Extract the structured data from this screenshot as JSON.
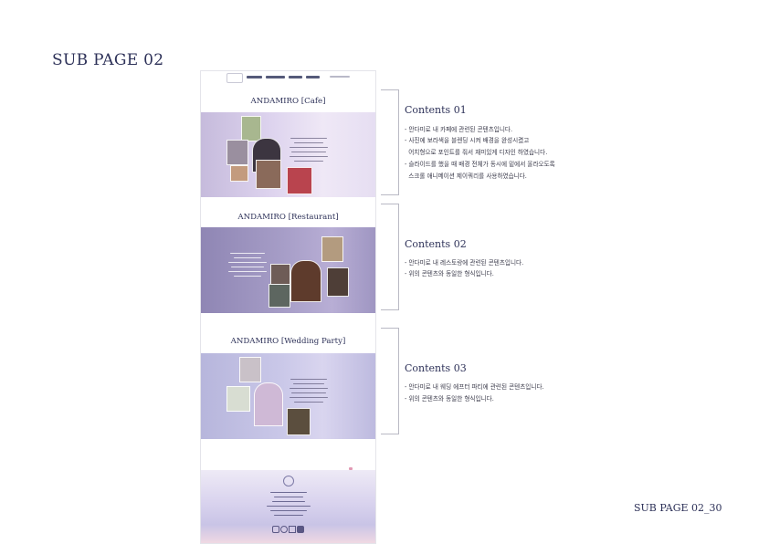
{
  "page": {
    "heading": "SUB PAGE 02",
    "page_number": "SUB PAGE 02_30"
  },
  "mockup": {
    "sections": [
      {
        "title": "ANDAMIRO [Cafe]"
      },
      {
        "title": "ANDAMIRO [Restaurant]"
      },
      {
        "title": "ANDAMIRO [Wedding Party]"
      }
    ]
  },
  "contents": [
    {
      "title": "Contents 01",
      "lines": [
        "- 안다미로 내 카페에 관련된 콘텐츠입니다.",
        "- 사진에 보라색을 블렌딩 시켜 배경을 완성시켰고",
        "  어치형으로 포인트를 줘서 재미있게 디자인 하였습니다.",
        "- 슬라이드를 했을 때 배경 전체가 동시에 밑에서 올라오도록",
        "  스크롤 애니메이션 제이쿼리를 사용하였습니다."
      ]
    },
    {
      "title": "Contents 02",
      "lines": [
        "- 안다미로 내 레스토랑에 관련된 콘텐츠입니다.",
        "- 위의 콘텐츠와 동일한 형식입니다."
      ]
    },
    {
      "title": "Contents 03",
      "lines": [
        "- 안다미로 내 웨딩 에프터 파티에 관련된 콘텐츠입니다.",
        "- 위의 콘텐츠와 동일한 형식입니다."
      ]
    }
  ],
  "colors": {
    "heading": "#2d3158",
    "cafe_band": "#ddd3ee",
    "restaurant_band": "#a59cc6",
    "wedding_band": "#c9c7e8",
    "bracket": "#b9b9c4"
  }
}
